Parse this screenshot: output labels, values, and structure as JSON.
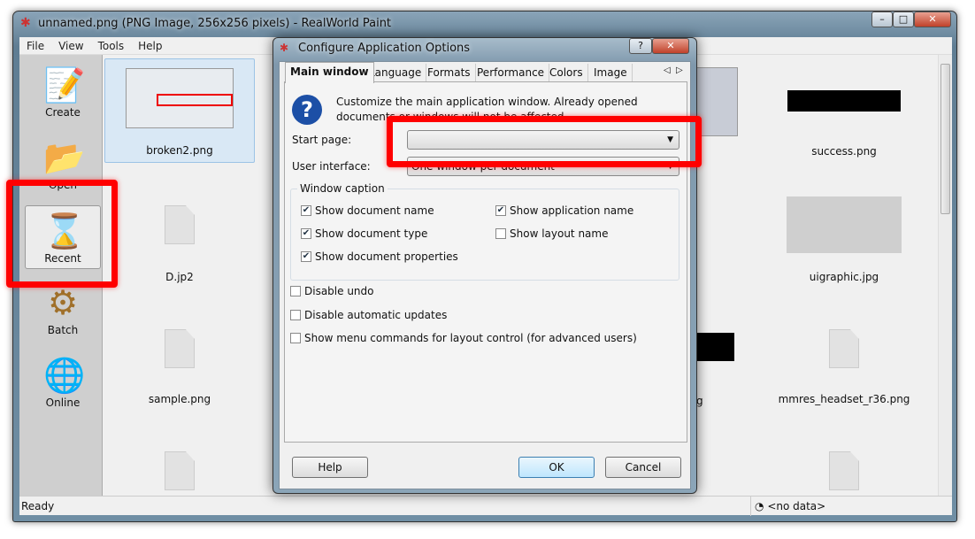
{
  "window": {
    "title": "unnamed.png (PNG Image, 256x256 pixels) - RealWorld Paint"
  },
  "menu": [
    "File",
    "View",
    "Tools",
    "Help"
  ],
  "sidebar": [
    {
      "label": "Create",
      "icon": "create-icon"
    },
    {
      "label": "Open",
      "icon": "folder-icon"
    },
    {
      "label": "Recent",
      "icon": "hourglass-icon"
    },
    {
      "label": "Batch",
      "icon": "gears-icon"
    },
    {
      "label": "Online",
      "icon": "globe-icon"
    }
  ],
  "files": [
    "broken2.png",
    "D.jp2",
    "sample.png",
    "success.png",
    "uigraphic.jpg",
    "mmres_headset_r36.png",
    "g"
  ],
  "status": {
    "left": "Ready",
    "right": "<no data>"
  },
  "dialog": {
    "title": "Configure Application Options",
    "tabs": [
      "Main window",
      "Language",
      "Formats",
      "Performance",
      "Colors",
      "Image"
    ],
    "info": "Customize the main application window. Already opened documents or windows will not be affected.",
    "start_page_label": "Start page:",
    "start_page_value": "",
    "ui_label": "User interface:",
    "ui_value": "One window per document",
    "group": "Window caption",
    "caption_options": [
      {
        "label": "Show document name",
        "checked": true
      },
      {
        "label": "Show application name",
        "checked": true
      },
      {
        "label": "Show document type",
        "checked": true
      },
      {
        "label": "Show layout name",
        "checked": false
      },
      {
        "label": "Show document properties",
        "checked": true
      }
    ],
    "options": [
      {
        "label": "Disable undo",
        "checked": false
      },
      {
        "label": "Disable automatic updates",
        "checked": false
      },
      {
        "label": "Show menu commands for layout control (for advanced users)",
        "checked": false
      }
    ],
    "help": "Help",
    "ok": "OK",
    "cancel": "Cancel"
  },
  "colors": {
    "highlight": "#ff0000",
    "accent": "#1c4fa6"
  }
}
